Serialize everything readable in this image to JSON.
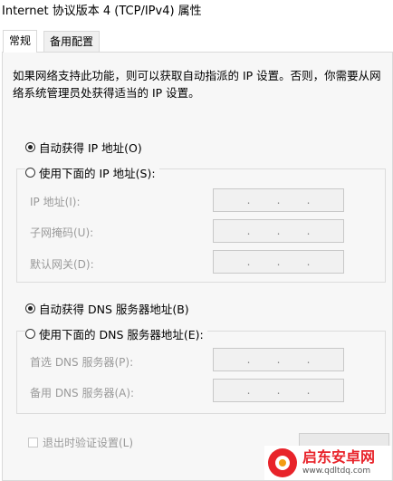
{
  "window": {
    "title": "Internet 协议版本 4 (TCP/IPv4) 属性"
  },
  "tabs": [
    {
      "label": "常规"
    },
    {
      "label": "备用配置"
    }
  ],
  "description": "如果网络支持此功能，则可以获取自动指派的 IP 设置。否则，你需要从网络系统管理员处获得适当的 IP 设置。",
  "ip_section": {
    "auto_label": "自动获得 IP 地址(O)",
    "manual_label": "使用下面的 IP 地址(S):",
    "fields": [
      {
        "label": "IP 地址(I):"
      },
      {
        "label": "子网掩码(U):"
      },
      {
        "label": "默认网关(D):"
      }
    ]
  },
  "dns_section": {
    "auto_label": "自动获得 DNS 服务器地址(B)",
    "manual_label": "使用下面的 DNS 服务器地址(E):",
    "fields": [
      {
        "label": "首选 DNS 服务器(P):"
      },
      {
        "label": "备用 DNS 服务器(A):"
      }
    ]
  },
  "validate_label": "退出时验证设置(L)",
  "watermark": {
    "brand": "启东安卓网",
    "url": "www.qdltdq.com"
  },
  "ip_placeholder": ".      .      ."
}
